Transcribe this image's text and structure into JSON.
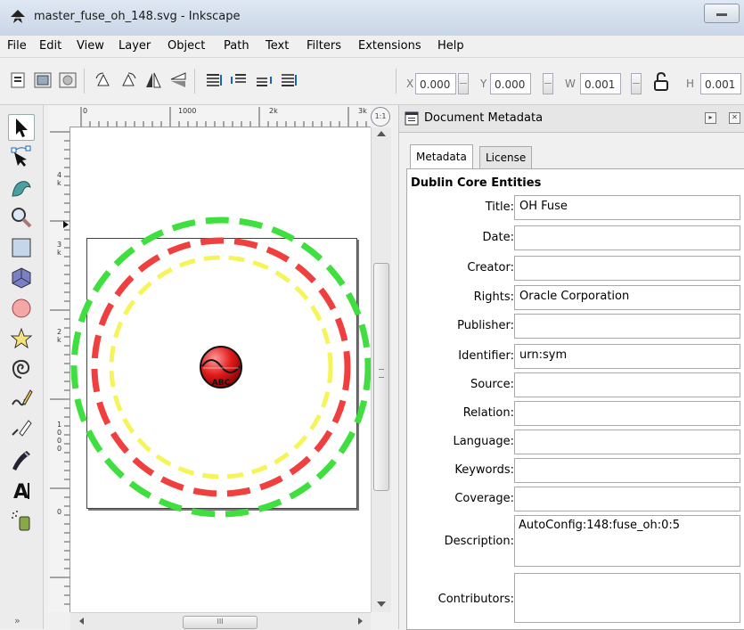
{
  "window": {
    "title": "master_fuse_oh_148.svg - Inkscape"
  },
  "menu": [
    "File",
    "Edit",
    "View",
    "Layer",
    "Object",
    "Path",
    "Text",
    "Filters",
    "Extensions",
    "Help"
  ],
  "toolbar": {
    "x_label": "X",
    "x_value": "0.000",
    "y_label": "Y",
    "y_value": "0.000",
    "w_label": "W",
    "w_value": "0.001",
    "h_label": "H",
    "h_value": "0.001"
  },
  "ruler": {
    "h_labels": [
      "0",
      "1000",
      "2k",
      "3k"
    ],
    "v_labels": [
      "4k",
      "3k",
      "2k",
      "1000",
      "0"
    ]
  },
  "canvas": {
    "logo_text": "ABC",
    "ring_colors": {
      "outer": "#3fdf3f",
      "middle": "#ef3f3f",
      "inner": "#f5f55a"
    }
  },
  "panel": {
    "title": "Document Metadata",
    "tabs": [
      "Metadata",
      "License"
    ],
    "section": "Dublin Core Entities",
    "fields": [
      {
        "label": "Title:",
        "value": "OH Fuse"
      },
      {
        "label": "Date:",
        "value": ""
      },
      {
        "label": "Creator:",
        "value": ""
      },
      {
        "label": "Rights:",
        "value": "Oracle Corporation"
      },
      {
        "label": "Publisher:",
        "value": ""
      },
      {
        "label": "Identifier:",
        "value": "urn:sym"
      },
      {
        "label": "Source:",
        "value": ""
      },
      {
        "label": "Relation:",
        "value": ""
      },
      {
        "label": "Language:",
        "value": ""
      },
      {
        "label": "Keywords:",
        "value": ""
      },
      {
        "label": "Coverage:",
        "value": ""
      },
      {
        "label": "Description:",
        "value": "AutoConfig:148:fuse_oh:0:5"
      },
      {
        "label": "Contributors:",
        "value": ""
      }
    ]
  }
}
